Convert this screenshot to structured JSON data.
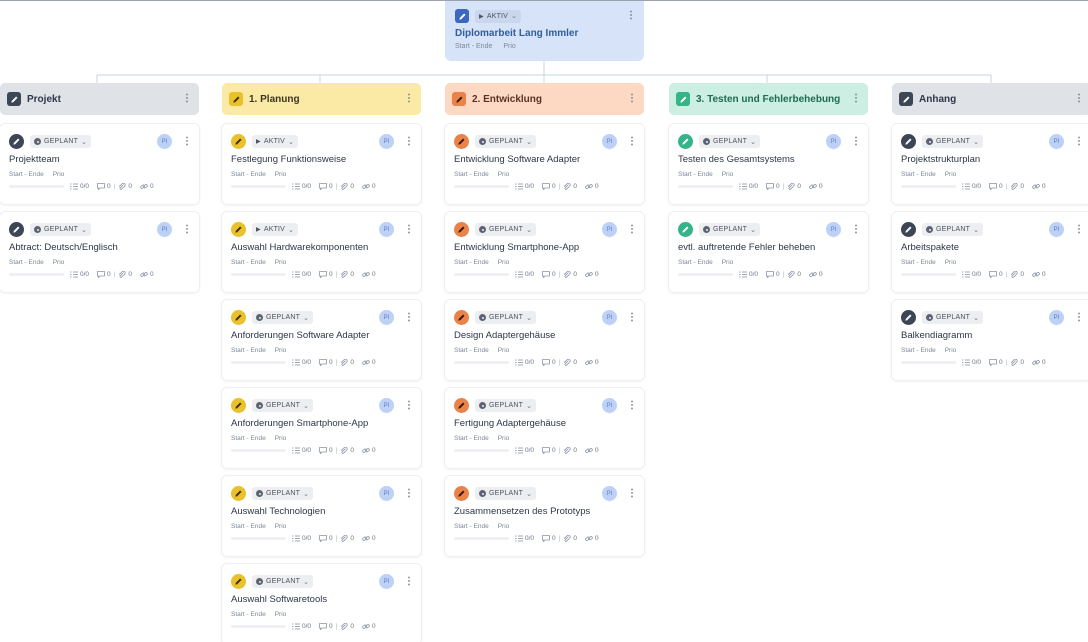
{
  "root": {
    "status": "AKTIV",
    "title": "Diplomarbeit Lang Immler",
    "start_end": "Start - Ende",
    "prio": "Prio"
  },
  "colors": {
    "root_bg": "#d7e3f8",
    "projekt": "#dfe2e6",
    "planung": "#fbeaa6",
    "entwicklung": "#fdd9c4",
    "testen": "#cdeee3",
    "anhang": "#dfe2e6"
  },
  "columns": [
    {
      "header": "Projekt",
      "icon": "pencil-icon",
      "cards": [
        {
          "status": "GEPLANT",
          "title": "Projektteam"
        },
        {
          "status": "GEPLANT",
          "title": "Abtract: Deutsch/Englisch"
        }
      ]
    },
    {
      "header": "1. Planung",
      "icon": "pencil-icon",
      "cards": [
        {
          "status": "AKTIV",
          "title": "Festlegung Funktionsweise"
        },
        {
          "status": "AKTIV",
          "title": "Auswahl Hardwarekomponenten"
        },
        {
          "status": "GEPLANT",
          "title": "Anforderungen Software Adapter"
        },
        {
          "status": "GEPLANT",
          "title": "Anforderungen Smartphone-App"
        },
        {
          "status": "GEPLANT",
          "title": "Auswahl Technologien"
        },
        {
          "status": "GEPLANT",
          "title": "Auswahl Softwaretools"
        }
      ]
    },
    {
      "header": "2. Entwicklung",
      "icon": "pencil-icon",
      "cards": [
        {
          "status": "GEPLANT",
          "title": "Entwicklung Software Adapter"
        },
        {
          "status": "GEPLANT",
          "title": "Entwicklung Smartphone-App"
        },
        {
          "status": "GEPLANT",
          "title": "Design Adaptergehäuse"
        },
        {
          "status": "GEPLANT",
          "title": "Fertigung Adaptergehäuse"
        },
        {
          "status": "GEPLANT",
          "title": "Zusammensetzen des Prototyps"
        }
      ]
    },
    {
      "header": "3. Testen und Fehlerbehebung",
      "icon": "pencil-icon",
      "cards": [
        {
          "status": "GEPLANT",
          "title": "Testen des Gesamtsystems"
        },
        {
          "status": "GEPLANT",
          "title": "evtl. auftretende Fehler beheben"
        }
      ]
    },
    {
      "header": "Anhang",
      "icon": "pencil-icon",
      "cards": [
        {
          "status": "GEPLANT",
          "title": "Projektstrukturplan"
        },
        {
          "status": "GEPLANT",
          "title": "Arbeitspakete"
        },
        {
          "status": "GEPLANT",
          "title": "Balkendiagramm"
        }
      ]
    }
  ],
  "card_common": {
    "avatar": "PI",
    "start_end": "Start - Ende",
    "prio": "Prio",
    "checklist": "0/0",
    "comments": "0",
    "attachments": "0",
    "links": "0"
  }
}
